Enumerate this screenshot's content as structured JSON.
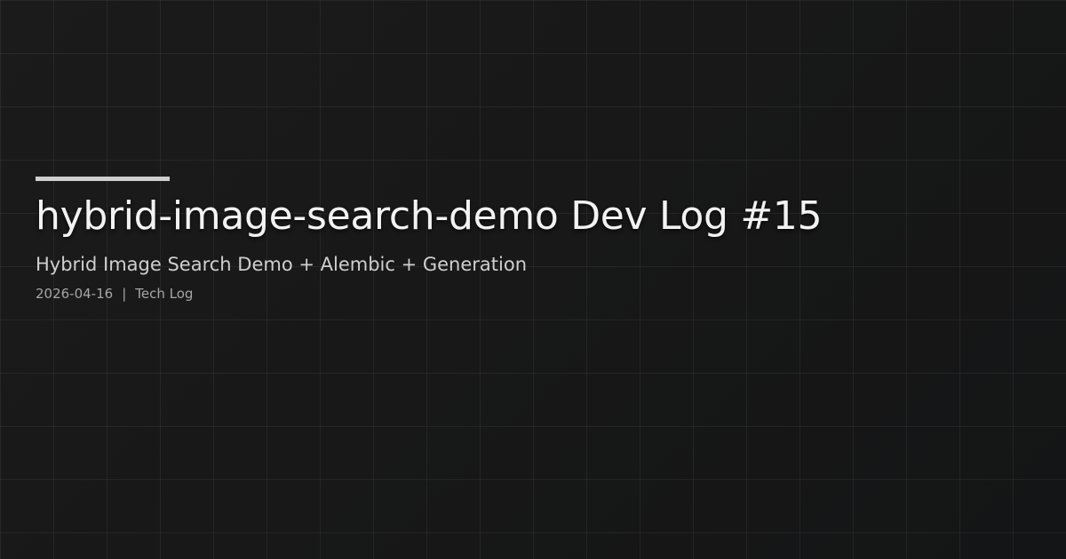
{
  "post": {
    "title": "hybrid-image-search-demo Dev Log #15",
    "subtitle": "Hybrid Image Search Demo + Alembic + Generation",
    "date": "2026-04-16",
    "separator": "|",
    "category": "Tech Log"
  },
  "colors": {
    "background": "#181818",
    "grid_line": "#2a2a2a",
    "accent_bar": "#cfcfcf",
    "title_text": "#f2f2f2",
    "subtitle_text": "#cfcfcf",
    "meta_text": "#a6a6a6"
  }
}
